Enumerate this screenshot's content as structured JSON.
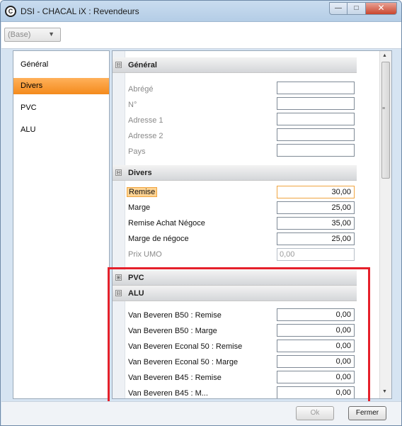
{
  "window": {
    "title": "DSI - CHACAL iX : Revendeurs",
    "app_icon": "C",
    "controls": {
      "minimize": "—",
      "maximize": "□",
      "close": "✕"
    }
  },
  "toolbar": {
    "base_select_value": "(Base)",
    "base_select_arrow": "▼"
  },
  "nav": {
    "items": [
      {
        "label": "Général"
      },
      {
        "label": "Divers",
        "active": true
      },
      {
        "label": "PVC"
      },
      {
        "label": "ALU"
      }
    ]
  },
  "grid": {
    "general": {
      "header": "Général",
      "toggle": "⊟",
      "rows": [
        {
          "label": "Abrégé",
          "value": ""
        },
        {
          "label": "N°",
          "value": ""
        },
        {
          "label": "Adresse 1",
          "value": ""
        },
        {
          "label": "Adresse 2",
          "value": ""
        },
        {
          "label": "Pays",
          "value": ""
        }
      ]
    },
    "divers": {
      "header": "Divers",
      "toggle": "⊟",
      "rows": [
        {
          "label": "Remise",
          "value": "30,00"
        },
        {
          "label": "Marge",
          "value": "25,00"
        },
        {
          "label": "Remise Achat Négoce",
          "value": "35,00"
        },
        {
          "label": "Marge de négoce",
          "value": "25,00"
        },
        {
          "label": "Prix UMO",
          "value": "0,00"
        }
      ]
    },
    "pvc": {
      "header": "PVC",
      "toggle": "⊞"
    },
    "alu": {
      "header": "ALU",
      "toggle": "⊟",
      "rows": [
        {
          "label": "Van Beveren B50 : Remise",
          "value": "0,00"
        },
        {
          "label": "Van Beveren B50 : Marge",
          "value": "0,00"
        },
        {
          "label": "Van Beveren Econal 50 : Remise",
          "value": "0,00"
        },
        {
          "label": "Van Beveren Econal 50 : Marge",
          "value": "0,00"
        },
        {
          "label": "Van Beveren B45 : Remise",
          "value": "0,00"
        },
        {
          "label": "Van Beveren B45 : M...",
          "value": "0,00"
        }
      ]
    }
  },
  "scrollbar": {
    "up": "▲",
    "down": "▼",
    "grip": "≡"
  },
  "footer": {
    "ok_label": "Ok",
    "close_label": "Fermer"
  },
  "colors": {
    "highlight": "#e5202b",
    "active_nav": "#f48a1c"
  }
}
